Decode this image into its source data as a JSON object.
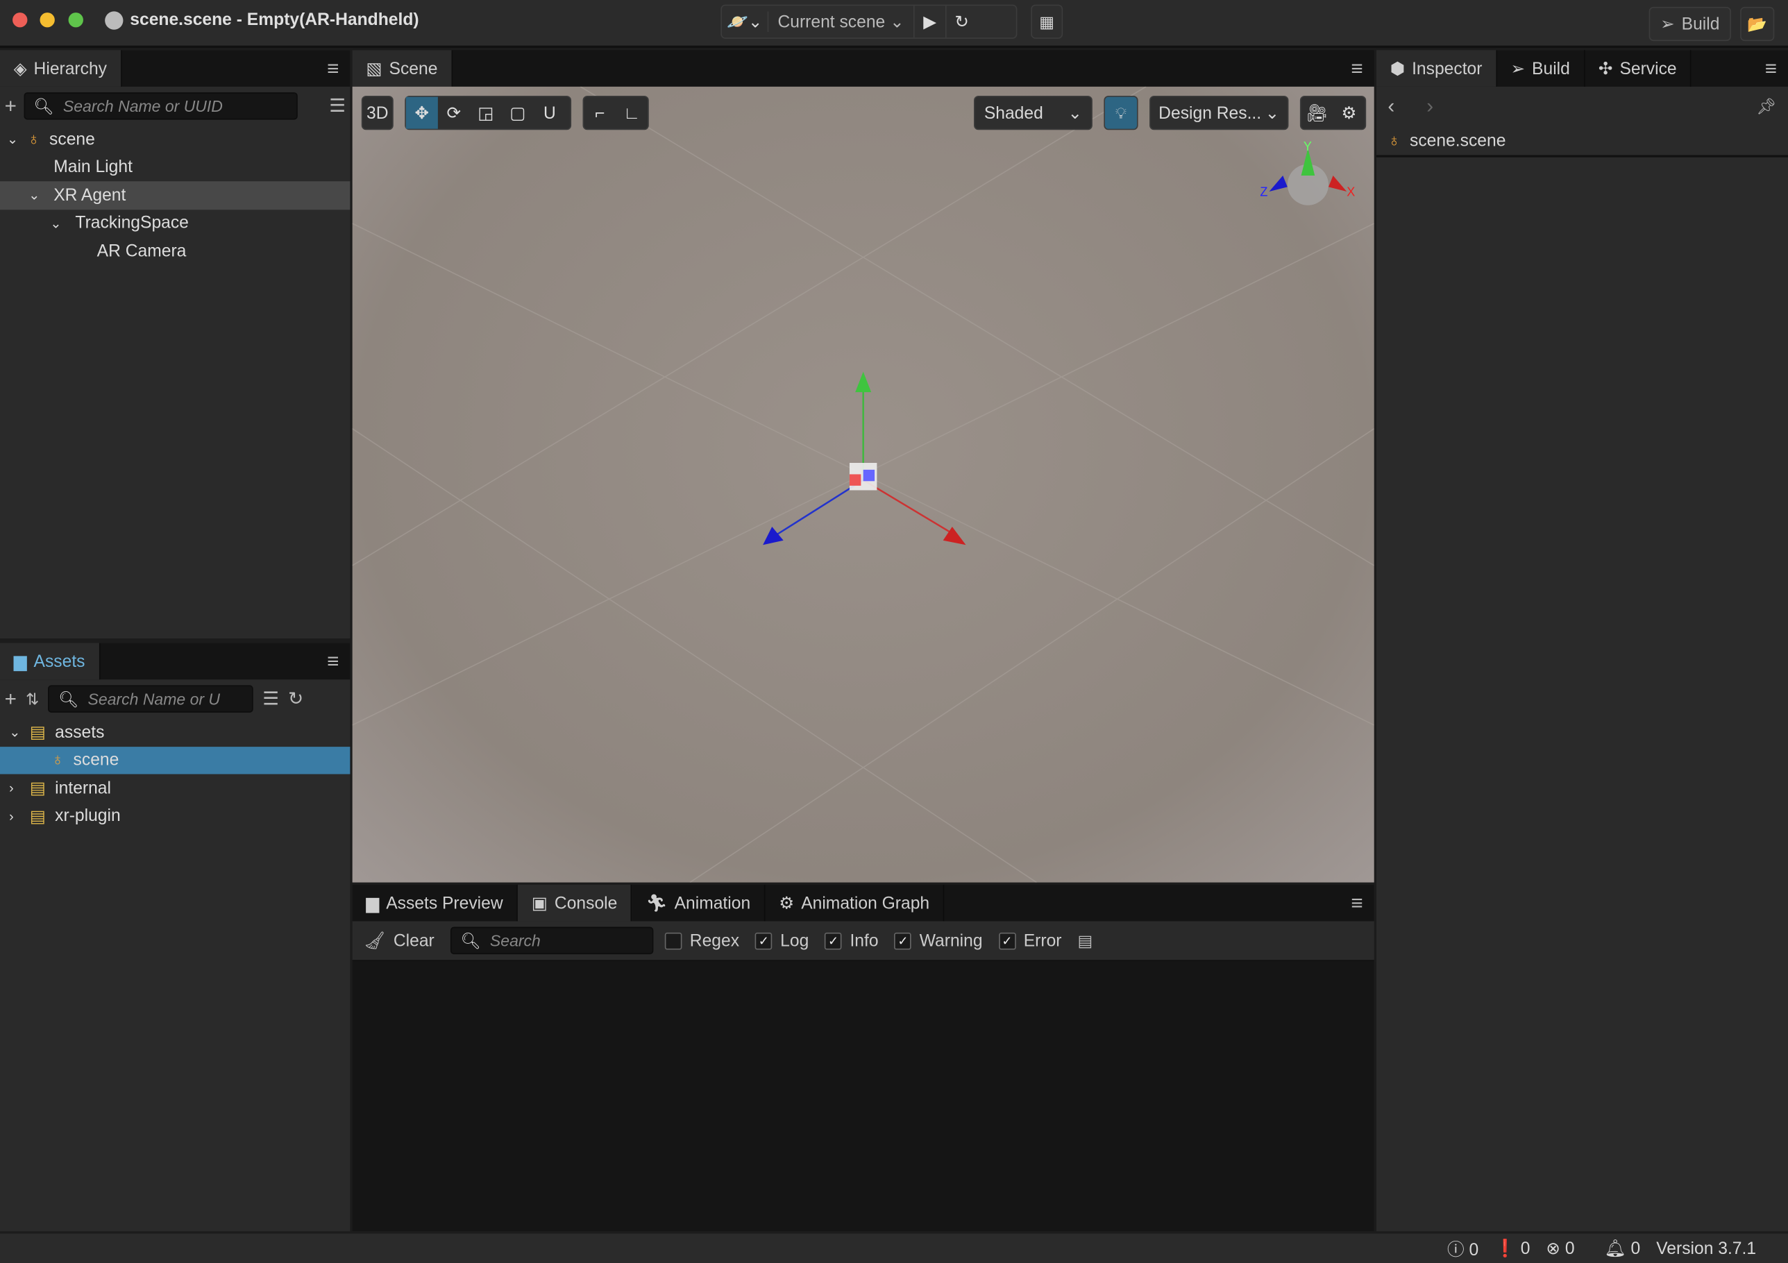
{
  "window": {
    "title": "scene.scene - Empty(AR-Handheld)"
  },
  "toolbar": {
    "scene_select": "Current scene",
    "build_label": "Build"
  },
  "hierarchy": {
    "tab": "Hierarchy",
    "search_placeholder": "Search Name or UUID",
    "items": [
      {
        "label": "scene",
        "depth": 0,
        "expanded": true
      },
      {
        "label": "Main Light",
        "depth": 1
      },
      {
        "label": "XR Agent",
        "depth": 1,
        "expanded": true,
        "selected": true
      },
      {
        "label": "TrackingSpace",
        "depth": 2,
        "expanded": true
      },
      {
        "label": "AR Camera",
        "depth": 3
      }
    ]
  },
  "assets": {
    "tab": "Assets",
    "search_placeholder": "Search Name or U",
    "items": [
      {
        "label": "assets",
        "depth": 0,
        "expanded": true
      },
      {
        "label": "scene",
        "depth": 1,
        "selected": true
      },
      {
        "label": "internal",
        "depth": 0
      },
      {
        "label": "xr-plugin",
        "depth": 0
      }
    ]
  },
  "scene": {
    "tab": "Scene",
    "mode_3d": "3D",
    "shading": "Shaded",
    "resolution": "Design Res...",
    "gizmo_axes": {
      "x": "X",
      "y": "Y",
      "z": "Z"
    }
  },
  "inspector": {
    "tabs": [
      "Inspector",
      "Build",
      "Service"
    ],
    "asset": "scene.scene"
  },
  "console": {
    "tabs": [
      "Assets Preview",
      "Console",
      "Animation",
      "Animation Graph"
    ],
    "active_tab": "Console",
    "clear": "Clear",
    "search_placeholder": "Search",
    "filters": [
      {
        "label": "Regex",
        "checked": false
      },
      {
        "label": "Log",
        "checked": true
      },
      {
        "label": "Info",
        "checked": true
      },
      {
        "label": "Warning",
        "checked": true
      },
      {
        "label": "Error",
        "checked": true
      }
    ]
  },
  "status": {
    "info_count": "0",
    "warn_count": "0",
    "error_count": "0",
    "notif_count": "0",
    "version": "Version 3.7.1"
  },
  "colors": {
    "accent": "#2d6583",
    "selected_row": "#3a7ca5",
    "folder": "#e0b84a",
    "scene_icon": "#e8a13a"
  }
}
